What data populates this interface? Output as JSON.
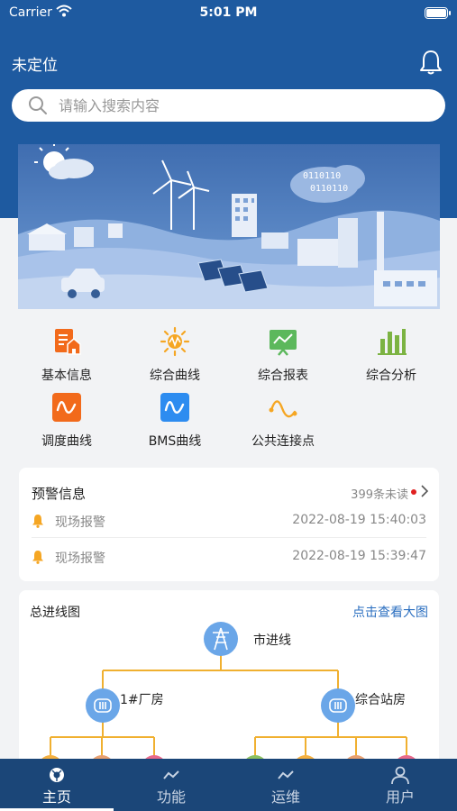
{
  "status_bar": {
    "carrier": "Carrier",
    "time": "5:01 PM"
  },
  "header": {
    "location": "未定位",
    "notification_icon": "bell-icon"
  },
  "search": {
    "placeholder": "请输入搜索内容"
  },
  "banner": {
    "binary_line1": "0110110",
    "binary_line2": "0110110"
  },
  "functions": [
    {
      "label": "基本信息",
      "icon": "building-doc-icon",
      "color": "#f26a1b"
    },
    {
      "label": "综合曲线",
      "icon": "sun-curve-icon",
      "color": "#f5a623"
    },
    {
      "label": "综合报表",
      "icon": "report-board-icon",
      "color": "#5cb85c"
    },
    {
      "label": "综合分析",
      "icon": "bar-analysis-icon",
      "color": "#7cb342"
    },
    {
      "label": "调度曲线",
      "icon": "wave-icon",
      "color": "#f26a1b"
    },
    {
      "label": "BMS曲线",
      "icon": "wave-icon",
      "color": "#2d8cf0"
    },
    {
      "label": "公共连接点",
      "icon": "connection-curve-icon",
      "color": "#f5a623"
    }
  ],
  "alerts": {
    "title": "预警信息",
    "unread": "399条未读",
    "items": [
      {
        "label": "现场报警",
        "time": "2022-08-19 15:40:03"
      },
      {
        "label": "现场报警",
        "time": "2022-08-19 15:39:47"
      }
    ]
  },
  "diagram": {
    "title": "总进线图",
    "link": "点击查看大图",
    "root": "市进线",
    "left_node": "1#厂房",
    "right_node": "综合站房"
  },
  "tabs": [
    {
      "label": "主页",
      "icon": "home-camera-icon",
      "active": true
    },
    {
      "label": "功能",
      "icon": "trend-icon",
      "active": false
    },
    {
      "label": "运维",
      "icon": "trend-icon",
      "active": false
    },
    {
      "label": "用户",
      "icon": "user-icon",
      "active": false
    }
  ],
  "colors": {
    "header": "#1e5aa0",
    "tabbar": "#1b4678",
    "link": "#2b6fc0",
    "diagram_line": "#f0b030",
    "node_fill": "#6aa6e8"
  }
}
